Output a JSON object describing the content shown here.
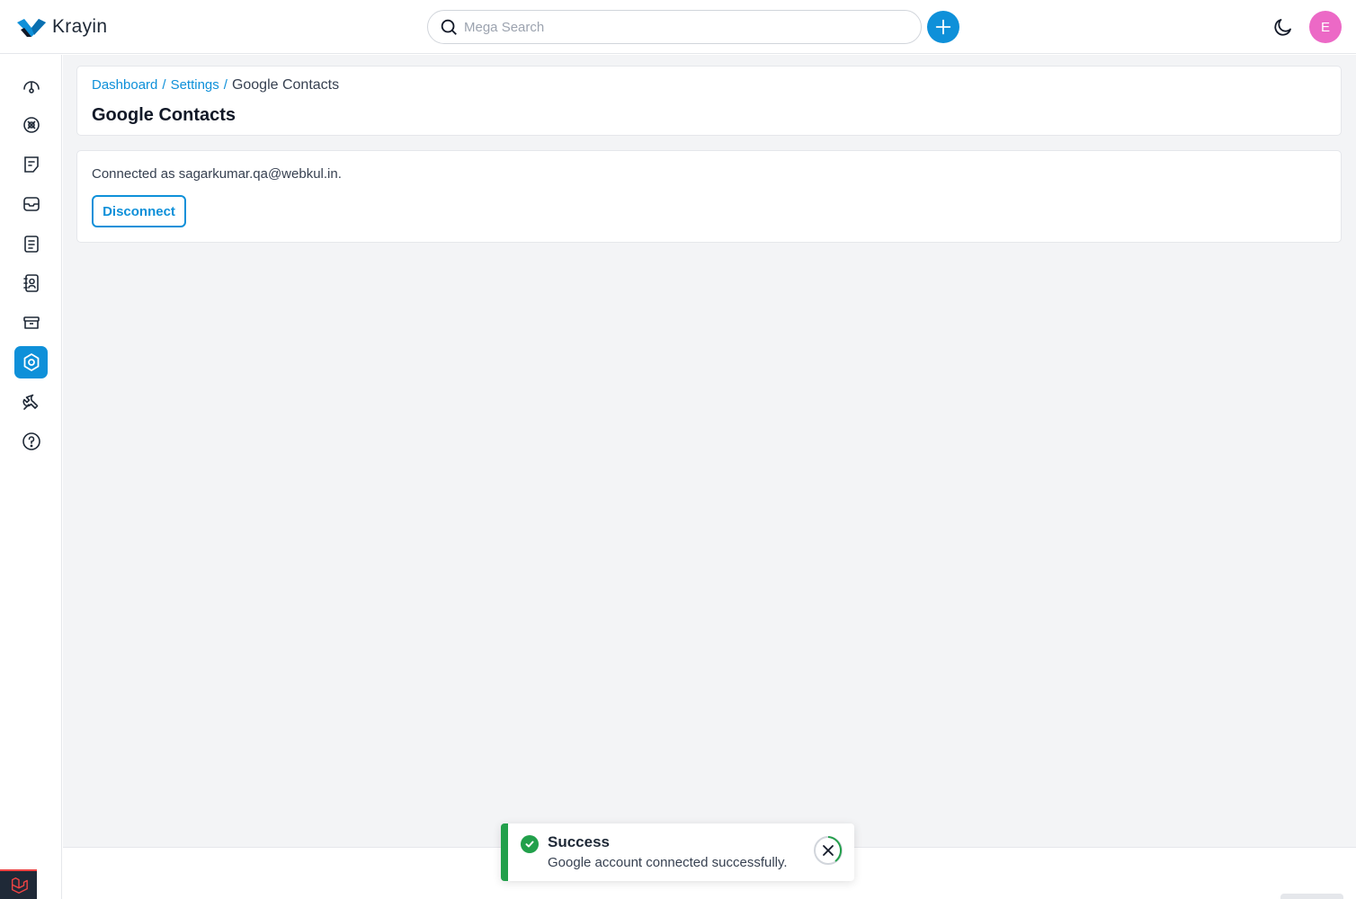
{
  "app": {
    "name": "Krayin"
  },
  "header": {
    "search_placeholder": "Mega Search",
    "avatar_initial": "E",
    "colors": {
      "accent": "#0e90d9",
      "avatar": "#ec69c6"
    },
    "icons": [
      "search-icon",
      "plus-icon",
      "moon-icon"
    ]
  },
  "sidebar": {
    "items": [
      {
        "name": "dashboard",
        "icon": "speedometer-icon",
        "active": false
      },
      {
        "name": "leads",
        "icon": "leads-icon",
        "active": false
      },
      {
        "name": "quotes",
        "icon": "quotes-icon",
        "active": false
      },
      {
        "name": "mail",
        "icon": "mail-icon",
        "active": false
      },
      {
        "name": "activities",
        "icon": "activity-icon",
        "active": false
      },
      {
        "name": "contacts",
        "icon": "contacts-icon",
        "active": false
      },
      {
        "name": "products",
        "icon": "product-icon",
        "active": false
      },
      {
        "name": "settings",
        "icon": "settings-icon",
        "active": true
      },
      {
        "name": "configuration",
        "icon": "wrench-icon",
        "active": false
      },
      {
        "name": "help",
        "icon": "help-icon",
        "active": false
      }
    ]
  },
  "breadcrumb": {
    "items": [
      "Dashboard",
      "Settings"
    ],
    "separator": "/",
    "current": "Google Contacts"
  },
  "page": {
    "title": "Google Contacts",
    "connected_text": "Connected as sagarkumar.qa@webkul.in.",
    "disconnect_label": "Disconnect"
  },
  "toast": {
    "title": "Success",
    "message": "Google account connected successfully.",
    "color": "#22a04b"
  }
}
